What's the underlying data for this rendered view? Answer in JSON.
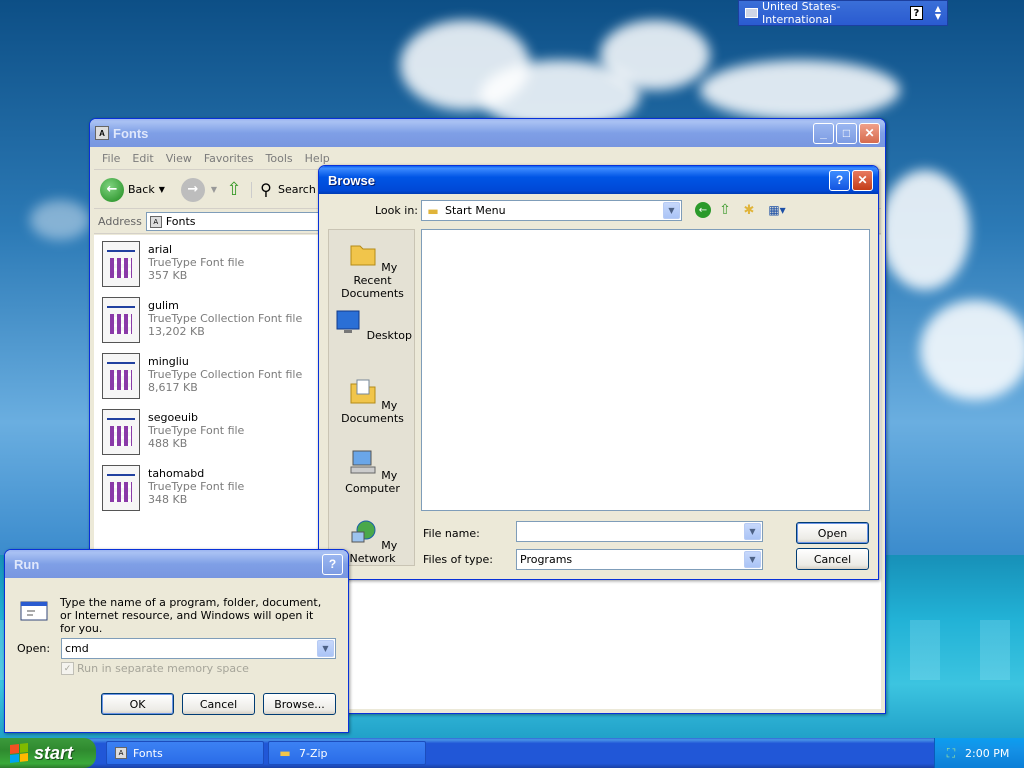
{
  "language_bar": {
    "language": "United States-International",
    "help_label": "?"
  },
  "fonts_window": {
    "title": "Fonts",
    "menu": [
      "File",
      "Edit",
      "View",
      "Favorites",
      "Tools",
      "Help"
    ],
    "toolbar": {
      "back_label": "Back",
      "search_label": "Search"
    },
    "address_label": "Address",
    "address_value": "Fonts",
    "files": [
      {
        "name": "arial",
        "type": "TrueType Font file",
        "size": "357 KB"
      },
      {
        "name": "gulim",
        "type": "TrueType Collection Font file",
        "size": "13,202 KB"
      },
      {
        "name": "mingliu",
        "type": "TrueType Collection Font file",
        "size": "8,617 KB"
      },
      {
        "name": "segoeuib",
        "type": "TrueType Font file",
        "size": "488 KB"
      },
      {
        "name": "tahomabd",
        "type": "TrueType Font file",
        "size": "348 KB"
      }
    ]
  },
  "browse_dialog": {
    "title": "Browse",
    "look_in_label": "Look in:",
    "look_in_value": "Start Menu",
    "places": [
      "My Recent Documents",
      "Desktop",
      "My Documents",
      "My Computer",
      "My Network"
    ],
    "file_name_label": "File name:",
    "file_name_value": "",
    "files_of_type_label": "Files of type:",
    "files_of_type_value": "Programs",
    "open_label": "Open",
    "cancel_label": "Cancel"
  },
  "run_dialog": {
    "title": "Run",
    "description": "Type the name of a program, folder, document, or Internet resource, and Windows will open it for you.",
    "open_label": "Open:",
    "open_value": "cmd",
    "separate_memory_label": "Run in separate memory space",
    "ok_label": "OK",
    "cancel_label": "Cancel",
    "browse_label": "Browse..."
  },
  "taskbar": {
    "start_label": "start",
    "tasks": [
      "Fonts",
      "7-Zip"
    ],
    "clock": "2:00 PM"
  }
}
